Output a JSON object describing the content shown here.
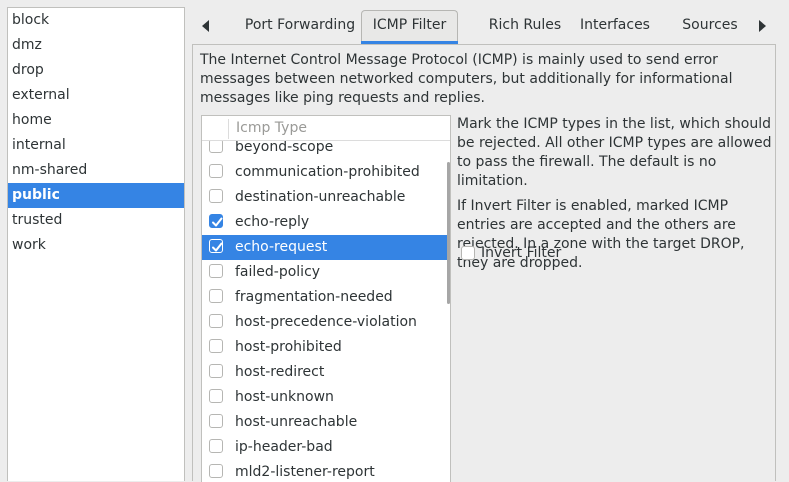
{
  "zones": {
    "items": [
      "block",
      "dmz",
      "drop",
      "external",
      "home",
      "internal",
      "nm-shared",
      "public",
      "trusted",
      "work"
    ],
    "selected": "public"
  },
  "tabs": {
    "left_arrow_icon": "triangle-left-icon",
    "right_arrow_icon": "triangle-right-icon",
    "items": [
      "Port Forwarding",
      "ICMP Filter",
      "Rich Rules",
      "Interfaces",
      "Sources"
    ],
    "active": "ICMP Filter"
  },
  "icmp": {
    "description": "The Internet Control Message Protocol (ICMP) is mainly used to send error messages between networked computers, but additionally for informational messages like ping requests and replies.",
    "column_header": "Icmp Type",
    "rows": [
      {
        "label": "beyond-scope",
        "checked": false,
        "selected": false
      },
      {
        "label": "communication-prohibited",
        "checked": false,
        "selected": false
      },
      {
        "label": "destination-unreachable",
        "checked": false,
        "selected": false
      },
      {
        "label": "echo-reply",
        "checked": true,
        "selected": false
      },
      {
        "label": "echo-request",
        "checked": true,
        "selected": true
      },
      {
        "label": "failed-policy",
        "checked": false,
        "selected": false
      },
      {
        "label": "fragmentation-needed",
        "checked": false,
        "selected": false
      },
      {
        "label": "host-precedence-violation",
        "checked": false,
        "selected": false
      },
      {
        "label": "host-prohibited",
        "checked": false,
        "selected": false
      },
      {
        "label": "host-redirect",
        "checked": false,
        "selected": false
      },
      {
        "label": "host-unknown",
        "checked": false,
        "selected": false
      },
      {
        "label": "host-unreachable",
        "checked": false,
        "selected": false
      },
      {
        "label": "ip-header-bad",
        "checked": false,
        "selected": false
      },
      {
        "label": "mld2-listener-report",
        "checked": false,
        "selected": false
      }
    ],
    "help_1": "Mark the ICMP types in the list, which should be rejected. All other ICMP types are allowed to pass the firewall. The default is no limitation.",
    "help_2": "If Invert Filter is enabled, marked ICMP entries are accepted and the others are rejected. In a zone with the target DROP, they are dropped.",
    "invert_label": "Invert Filter",
    "invert_checked": false
  },
  "colors": {
    "accent": "#3584e4"
  }
}
